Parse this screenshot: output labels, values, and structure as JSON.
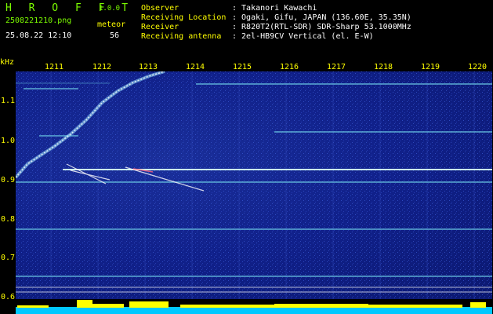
{
  "header": {
    "app_title": "H R O F F T",
    "version": "1.0.0",
    "filename": "2508221210.png",
    "datetime": "25.08.22 12:10",
    "mode_label": "meteor",
    "count": "56",
    "info": [
      {
        "label": "Observer",
        "value": ": Takanori Kawachi"
      },
      {
        "label": "Receiving Location",
        "value": ": Ogaki, Gifu, JAPAN (136.60E, 35.35N)"
      },
      {
        "label": "Receiver",
        "value": ": R820T2(RTL-SDR) SDR-Sharp 53.1000MHz"
      },
      {
        "label": "Receiving antenna",
        "value": ": 2el-HB9CV Vertical (el. E-W)"
      }
    ]
  },
  "spectrogram": {
    "y_unit": "kHz",
    "x_ticks": [
      "1211",
      "1212",
      "1213",
      "1214",
      "1215",
      "1216",
      "1217",
      "1218",
      "1219",
      "1220"
    ],
    "y_ticks": [
      "1.1",
      "1.0",
      "0.9",
      "0.8",
      "0.7",
      "0.6"
    ],
    "colors": {
      "background": "#0b1870",
      "echo": "#ffffff",
      "carrier": "#a0ffd0",
      "axis": "#FFFF00"
    }
  }
}
